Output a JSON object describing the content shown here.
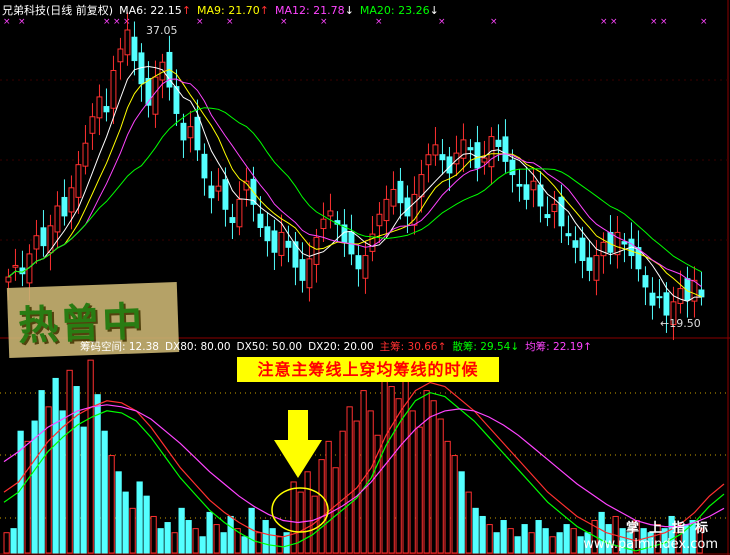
{
  "header": {
    "title": "兄弟科技(日线 前复权)",
    "ma": [
      {
        "label": "MA6: 22.15",
        "color": "#ffffff",
        "arrow": "↑",
        "arrow_color": "#ff3030"
      },
      {
        "label": "MA9: 21.70",
        "color": "#ffff00",
        "arrow": "↑",
        "arrow_color": "#ff3030"
      },
      {
        "label": "MA12: 21.78",
        "color": "#ff44ff",
        "arrow": "↓",
        "arrow_color": "#ffffff"
      },
      {
        "label": "MA20: 23.26",
        "color": "#00ff00",
        "arrow": "↓",
        "arrow_color": "#ffffff"
      }
    ]
  },
  "annotations": {
    "high": "37.05",
    "low": "←19.50"
  },
  "stamp": {
    "text": "热曾中"
  },
  "sub_header": {
    "title": "筹码空间: 12.38",
    "items": [
      {
        "label": "DX80: 80.00",
        "color": "#ffffff"
      },
      {
        "label": "DX50: 50.00",
        "color": "#ffffff"
      },
      {
        "label": "DX20: 20.00",
        "color": "#ffffff"
      },
      {
        "label": "主筹: 30.66",
        "color": "#ff3030",
        "arrow": "↑"
      },
      {
        "label": "散筹: 29.54",
        "color": "#00ff00",
        "arrow": "↓"
      },
      {
        "label": "均筹: 22.19",
        "color": "#ff44ff",
        "arrow": "↑"
      }
    ]
  },
  "callout": "注意主筹线上穿均筹线的时候",
  "watermark": {
    "line1": "掌上指标",
    "line2": "www.palmindex.com"
  },
  "colors": {
    "up": "#ff3030",
    "down": "#54ffff",
    "ma6": "#ffffff",
    "ma9": "#ffff00",
    "ma12": "#ff44ff",
    "ma20": "#00ff00",
    "grid": "#8b0000"
  },
  "chart_data": {
    "type": "candlestick",
    "price_range": [
      19.5,
      37.05
    ],
    "closes": [
      22.1,
      22.8,
      22.3,
      23.5,
      24.6,
      24.0,
      25.2,
      26.4,
      25.8,
      27.5,
      28.9,
      30.2,
      31.8,
      33.0,
      32.1,
      34.6,
      35.9,
      37.05,
      35.2,
      33.8,
      32.5,
      34.2,
      35.1,
      33.6,
      32.0,
      30.4,
      31.2,
      29.8,
      28.1,
      26.9,
      27.6,
      26.2,
      25.4,
      26.8,
      27.9,
      26.5,
      25.1,
      24.3,
      23.6,
      24.8,
      23.9,
      22.7,
      21.9,
      23.2,
      24.5,
      25.6,
      26.1,
      25.3,
      24.2,
      23.5,
      22.6,
      23.4,
      24.7,
      25.9,
      26.8,
      27.4,
      26.6,
      25.8,
      27.1,
      28.3,
      29.5,
      30.1,
      29.2,
      28.4,
      29.6,
      30.4,
      29.8,
      28.7,
      29.3,
      30.6,
      30.0,
      29.1,
      28.3,
      27.6,
      26.8,
      27.9,
      26.4,
      25.7,
      26.5,
      25.2,
      24.6,
      23.9,
      23.1,
      22.5,
      23.4,
      24.2,
      23.6,
      24.8,
      24.1,
      23.4,
      22.6,
      21.5,
      20.4,
      20.9,
      19.8,
      20.6,
      21.4,
      20.7,
      21.9,
      20.9
    ],
    "volume_scaled": [
      0.1,
      0.12,
      0.6,
      0.55,
      0.65,
      0.8,
      0.72,
      0.86,
      0.7,
      0.9,
      0.82,
      0.62,
      0.95,
      0.78,
      0.6,
      0.48,
      0.4,
      0.3,
      0.22,
      0.35,
      0.28,
      0.18,
      0.12,
      0.15,
      0.1,
      0.22,
      0.16,
      0.12,
      0.08,
      0.2,
      0.14,
      0.1,
      0.18,
      0.12,
      0.08,
      0.22,
      0.1,
      0.16,
      0.12,
      0.08,
      0.1,
      0.35,
      0.3,
      0.4,
      0.28,
      0.46,
      0.55,
      0.42,
      0.6,
      0.72,
      0.65,
      0.8,
      0.7,
      0.58,
      0.9,
      0.82,
      0.76,
      0.86,
      0.7,
      0.62,
      0.8,
      0.75,
      0.66,
      0.55,
      0.48,
      0.4,
      0.3,
      0.22,
      0.18,
      0.14,
      0.1,
      0.16,
      0.12,
      0.08,
      0.14,
      0.1,
      0.16,
      0.12,
      0.08,
      0.1,
      0.14,
      0.12,
      0.08,
      0.1,
      0.16,
      0.2,
      0.14,
      0.18,
      0.12,
      0.1,
      0.16,
      0.12,
      0.1,
      0.14,
      0.12,
      0.18,
      0.1,
      0.14,
      0.16,
      0.12
    ],
    "main_chip": [
      0.3,
      0.35,
      0.45,
      0.55,
      0.62,
      0.68,
      0.72,
      0.75,
      0.74,
      0.7,
      0.62,
      0.52,
      0.42,
      0.34,
      0.26,
      0.2,
      0.15,
      0.11,
      0.09,
      0.08,
      0.1,
      0.14,
      0.2,
      0.26,
      0.32,
      0.42,
      0.58,
      0.7,
      0.8,
      0.84,
      0.82,
      0.76,
      0.7,
      0.62,
      0.54,
      0.46,
      0.38,
      0.3,
      0.24,
      0.18,
      0.14,
      0.1,
      0.08,
      0.06,
      0.08,
      0.1,
      0.14,
      0.2,
      0.28,
      0.34
    ],
    "avg_chip": [
      0.45,
      0.5,
      0.56,
      0.62,
      0.66,
      0.7,
      0.72,
      0.73,
      0.72,
      0.7,
      0.66,
      0.6,
      0.54,
      0.47,
      0.4,
      0.34,
      0.28,
      0.23,
      0.19,
      0.16,
      0.15,
      0.16,
      0.19,
      0.23,
      0.28,
      0.35,
      0.44,
      0.53,
      0.61,
      0.67,
      0.7,
      0.71,
      0.7,
      0.67,
      0.63,
      0.58,
      0.52,
      0.46,
      0.4,
      0.34,
      0.29,
      0.24,
      0.2,
      0.16,
      0.14,
      0.13,
      0.13,
      0.15,
      0.18,
      0.22
    ]
  }
}
